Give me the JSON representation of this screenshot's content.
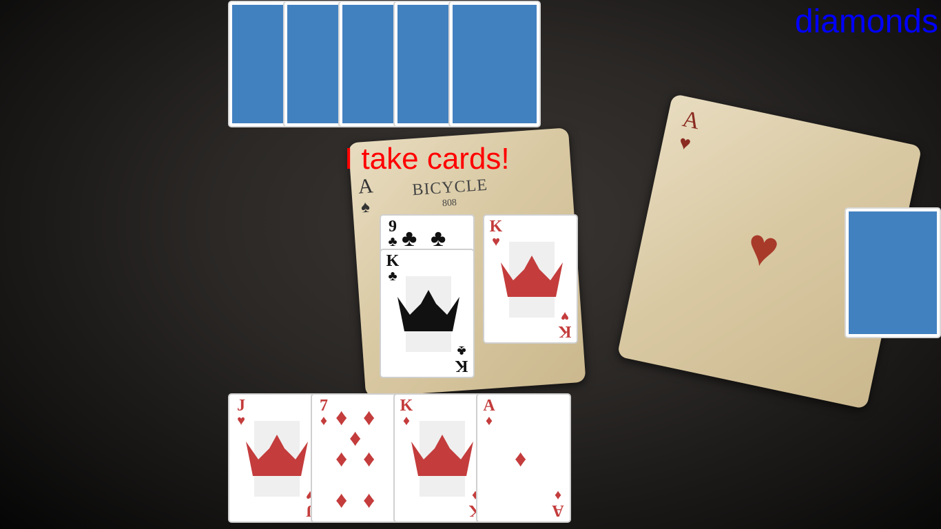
{
  "trump": {
    "label": "diamonds"
  },
  "message": {
    "text": "I take cards!"
  },
  "background_photo": {
    "spade_card_rank": "A",
    "spade_card_brand": "BICYCLE",
    "spade_card_number": "808",
    "heart_card_rank": "A"
  },
  "opponent_hand": {
    "card_count": 5
  },
  "deck": {
    "visible": true
  },
  "table": {
    "cards": [
      {
        "rank": "9",
        "suit": "♣",
        "color": "black"
      },
      {
        "rank": "K",
        "suit": "♣",
        "color": "black"
      },
      {
        "rank": "K",
        "suit": "♥",
        "color": "red"
      }
    ]
  },
  "player_hand": {
    "cards": [
      {
        "rank": "J",
        "suit": "♥",
        "color": "red"
      },
      {
        "rank": "7",
        "suit": "♦",
        "color": "red"
      },
      {
        "rank": "K",
        "suit": "♦",
        "color": "red"
      },
      {
        "rank": "A",
        "suit": "♦",
        "color": "red"
      }
    ]
  },
  "colors": {
    "card_back": "#4281c0",
    "red_suit": "#c43c3c",
    "message": "#ff0000",
    "trump": "#0000ff"
  }
}
